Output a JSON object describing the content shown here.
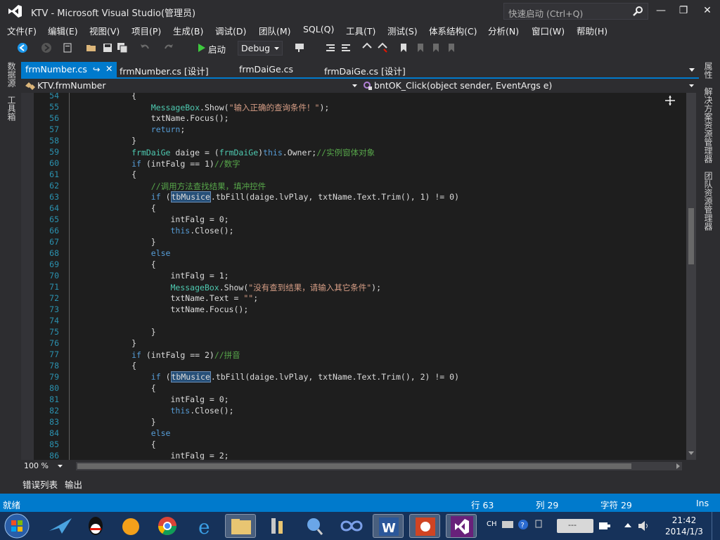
{
  "window": {
    "title": "KTV - Microsoft Visual Studio(管理员)",
    "quick_launch_placeholder": "快速启动 (Ctrl+Q)"
  },
  "menu": [
    "文件(F)",
    "编辑(E)",
    "视图(V)",
    "项目(P)",
    "生成(B)",
    "调试(D)",
    "团队(M)",
    "SQL(Q)",
    "工具(T)",
    "测试(S)",
    "体系结构(C)",
    "分析(N)",
    "窗口(W)",
    "帮助(H)"
  ],
  "toolbar": {
    "start_label": "启动",
    "config": "Debug"
  },
  "left_panels": [
    "数据源",
    "工具箱"
  ],
  "right_panels": [
    "属性",
    "解决方案资源管理器",
    "团队资源管理器"
  ],
  "tabs": [
    {
      "label": "frmNumber.cs",
      "active": true
    },
    {
      "label": "frmNumber.cs [设计]"
    },
    {
      "label": "frmDaiGe.cs"
    },
    {
      "label": "frmDaiGe.cs [设计]"
    }
  ],
  "nav": {
    "class_name": "KTV.frmNumber",
    "member_name": "bntOK_Click(object sender, EventArgs e)"
  },
  "code_lines": [
    {
      "n": "54",
      "c": "            {"
    },
    {
      "n": "55",
      "c": "                MessageBox.Show(\"输入正确的查询条件！\");"
    },
    {
      "n": "56",
      "c": "                txtName.Focus();"
    },
    {
      "n": "57",
      "c": "                return;"
    },
    {
      "n": "58",
      "c": "            }"
    },
    {
      "n": "59",
      "c": "            frmDaiGe daige = (frmDaiGe)this.Owner;//实例窗体对象"
    },
    {
      "n": "60",
      "c": "            if (intFalg == 1)//数字"
    },
    {
      "n": "61",
      "c": "            {"
    },
    {
      "n": "62",
      "c": "                //调用方法查找结果，填冲控件"
    },
    {
      "n": "63",
      "c": "                if (tbMusice.tbFill(daige.lvPlay, txtName.Text.Trim(), 1) != 0)"
    },
    {
      "n": "64",
      "c": "                {"
    },
    {
      "n": "65",
      "c": "                    intFalg = 0;"
    },
    {
      "n": "66",
      "c": "                    this.Close();"
    },
    {
      "n": "67",
      "c": "                }"
    },
    {
      "n": "68",
      "c": "                else"
    },
    {
      "n": "69",
      "c": "                {"
    },
    {
      "n": "70",
      "c": "                    intFalg = 1;"
    },
    {
      "n": "71",
      "c": "                    MessageBox.Show(\"没有查到结果，请输入其它条件\");"
    },
    {
      "n": "72",
      "c": "                    txtName.Text = \"\";"
    },
    {
      "n": "73",
      "c": "                    txtName.Focus();"
    },
    {
      "n": "74",
      "c": ""
    },
    {
      "n": "75",
      "c": "                }"
    },
    {
      "n": "76",
      "c": "            }"
    },
    {
      "n": "77",
      "c": "            if (intFalg == 2)//拼音"
    },
    {
      "n": "78",
      "c": "            {"
    },
    {
      "n": "79",
      "c": "                if (tbMusice.tbFill(daige.lvPlay, txtName.Text.Trim(), 2) != 0)"
    },
    {
      "n": "80",
      "c": "                {"
    },
    {
      "n": "81",
      "c": "                    intFalg = 0;"
    },
    {
      "n": "82",
      "c": "                    this.Close();"
    },
    {
      "n": "83",
      "c": "                }"
    },
    {
      "n": "84",
      "c": "                else"
    },
    {
      "n": "85",
      "c": "                {"
    },
    {
      "n": "86",
      "c": "                    intFalg = 2;"
    }
  ],
  "zoom": "100 %",
  "output_tabs": [
    "错误列表",
    "输出"
  ],
  "status": {
    "ready": "就绪",
    "line": "行 63",
    "col": "列 29",
    "char": "字符 29",
    "mode": "Ins"
  },
  "taskbar": {
    "time": "21:42",
    "date": "2014/1/3",
    "ime": "CH"
  }
}
